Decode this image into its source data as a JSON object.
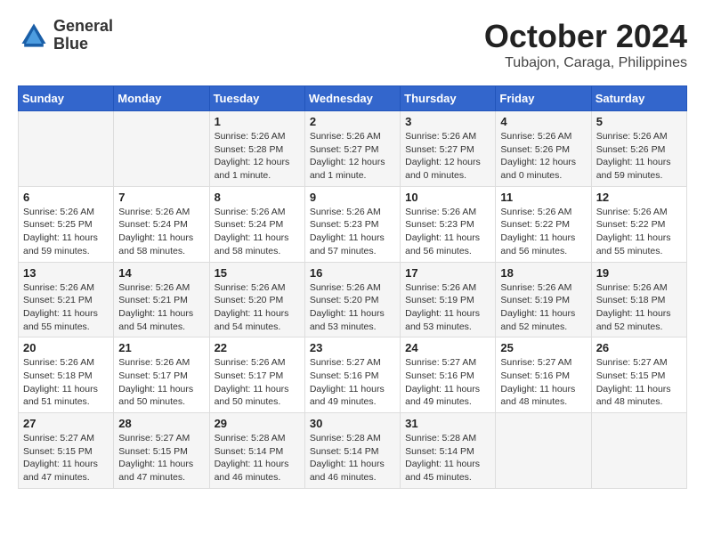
{
  "header": {
    "logo_text_line1": "General",
    "logo_text_line2": "Blue",
    "month_year": "October 2024",
    "location": "Tubajon, Caraga, Philippines"
  },
  "weekdays": [
    "Sunday",
    "Monday",
    "Tuesday",
    "Wednesday",
    "Thursday",
    "Friday",
    "Saturday"
  ],
  "rows": [
    [
      {
        "day": "",
        "lines": []
      },
      {
        "day": "",
        "lines": []
      },
      {
        "day": "1",
        "lines": [
          "Sunrise: 5:26 AM",
          "Sunset: 5:28 PM",
          "Daylight: 12 hours",
          "and 1 minute."
        ]
      },
      {
        "day": "2",
        "lines": [
          "Sunrise: 5:26 AM",
          "Sunset: 5:27 PM",
          "Daylight: 12 hours",
          "and 1 minute."
        ]
      },
      {
        "day": "3",
        "lines": [
          "Sunrise: 5:26 AM",
          "Sunset: 5:27 PM",
          "Daylight: 12 hours",
          "and 0 minutes."
        ]
      },
      {
        "day": "4",
        "lines": [
          "Sunrise: 5:26 AM",
          "Sunset: 5:26 PM",
          "Daylight: 12 hours",
          "and 0 minutes."
        ]
      },
      {
        "day": "5",
        "lines": [
          "Sunrise: 5:26 AM",
          "Sunset: 5:26 PM",
          "Daylight: 11 hours",
          "and 59 minutes."
        ]
      }
    ],
    [
      {
        "day": "6",
        "lines": [
          "Sunrise: 5:26 AM",
          "Sunset: 5:25 PM",
          "Daylight: 11 hours",
          "and 59 minutes."
        ]
      },
      {
        "day": "7",
        "lines": [
          "Sunrise: 5:26 AM",
          "Sunset: 5:24 PM",
          "Daylight: 11 hours",
          "and 58 minutes."
        ]
      },
      {
        "day": "8",
        "lines": [
          "Sunrise: 5:26 AM",
          "Sunset: 5:24 PM",
          "Daylight: 11 hours",
          "and 58 minutes."
        ]
      },
      {
        "day": "9",
        "lines": [
          "Sunrise: 5:26 AM",
          "Sunset: 5:23 PM",
          "Daylight: 11 hours",
          "and 57 minutes."
        ]
      },
      {
        "day": "10",
        "lines": [
          "Sunrise: 5:26 AM",
          "Sunset: 5:23 PM",
          "Daylight: 11 hours",
          "and 56 minutes."
        ]
      },
      {
        "day": "11",
        "lines": [
          "Sunrise: 5:26 AM",
          "Sunset: 5:22 PM",
          "Daylight: 11 hours",
          "and 56 minutes."
        ]
      },
      {
        "day": "12",
        "lines": [
          "Sunrise: 5:26 AM",
          "Sunset: 5:22 PM",
          "Daylight: 11 hours",
          "and 55 minutes."
        ]
      }
    ],
    [
      {
        "day": "13",
        "lines": [
          "Sunrise: 5:26 AM",
          "Sunset: 5:21 PM",
          "Daylight: 11 hours",
          "and 55 minutes."
        ]
      },
      {
        "day": "14",
        "lines": [
          "Sunrise: 5:26 AM",
          "Sunset: 5:21 PM",
          "Daylight: 11 hours",
          "and 54 minutes."
        ]
      },
      {
        "day": "15",
        "lines": [
          "Sunrise: 5:26 AM",
          "Sunset: 5:20 PM",
          "Daylight: 11 hours",
          "and 54 minutes."
        ]
      },
      {
        "day": "16",
        "lines": [
          "Sunrise: 5:26 AM",
          "Sunset: 5:20 PM",
          "Daylight: 11 hours",
          "and 53 minutes."
        ]
      },
      {
        "day": "17",
        "lines": [
          "Sunrise: 5:26 AM",
          "Sunset: 5:19 PM",
          "Daylight: 11 hours",
          "and 53 minutes."
        ]
      },
      {
        "day": "18",
        "lines": [
          "Sunrise: 5:26 AM",
          "Sunset: 5:19 PM",
          "Daylight: 11 hours",
          "and 52 minutes."
        ]
      },
      {
        "day": "19",
        "lines": [
          "Sunrise: 5:26 AM",
          "Sunset: 5:18 PM",
          "Daylight: 11 hours",
          "and 52 minutes."
        ]
      }
    ],
    [
      {
        "day": "20",
        "lines": [
          "Sunrise: 5:26 AM",
          "Sunset: 5:18 PM",
          "Daylight: 11 hours",
          "and 51 minutes."
        ]
      },
      {
        "day": "21",
        "lines": [
          "Sunrise: 5:26 AM",
          "Sunset: 5:17 PM",
          "Daylight: 11 hours",
          "and 50 minutes."
        ]
      },
      {
        "day": "22",
        "lines": [
          "Sunrise: 5:26 AM",
          "Sunset: 5:17 PM",
          "Daylight: 11 hours",
          "and 50 minutes."
        ]
      },
      {
        "day": "23",
        "lines": [
          "Sunrise: 5:27 AM",
          "Sunset: 5:16 PM",
          "Daylight: 11 hours",
          "and 49 minutes."
        ]
      },
      {
        "day": "24",
        "lines": [
          "Sunrise: 5:27 AM",
          "Sunset: 5:16 PM",
          "Daylight: 11 hours",
          "and 49 minutes."
        ]
      },
      {
        "day": "25",
        "lines": [
          "Sunrise: 5:27 AM",
          "Sunset: 5:16 PM",
          "Daylight: 11 hours",
          "and 48 minutes."
        ]
      },
      {
        "day": "26",
        "lines": [
          "Sunrise: 5:27 AM",
          "Sunset: 5:15 PM",
          "Daylight: 11 hours",
          "and 48 minutes."
        ]
      }
    ],
    [
      {
        "day": "27",
        "lines": [
          "Sunrise: 5:27 AM",
          "Sunset: 5:15 PM",
          "Daylight: 11 hours",
          "and 47 minutes."
        ]
      },
      {
        "day": "28",
        "lines": [
          "Sunrise: 5:27 AM",
          "Sunset: 5:15 PM",
          "Daylight: 11 hours",
          "and 47 minutes."
        ]
      },
      {
        "day": "29",
        "lines": [
          "Sunrise: 5:28 AM",
          "Sunset: 5:14 PM",
          "Daylight: 11 hours",
          "and 46 minutes."
        ]
      },
      {
        "day": "30",
        "lines": [
          "Sunrise: 5:28 AM",
          "Sunset: 5:14 PM",
          "Daylight: 11 hours",
          "and 46 minutes."
        ]
      },
      {
        "day": "31",
        "lines": [
          "Sunrise: 5:28 AM",
          "Sunset: 5:14 PM",
          "Daylight: 11 hours",
          "and 45 minutes."
        ]
      },
      {
        "day": "",
        "lines": []
      },
      {
        "day": "",
        "lines": []
      }
    ]
  ]
}
